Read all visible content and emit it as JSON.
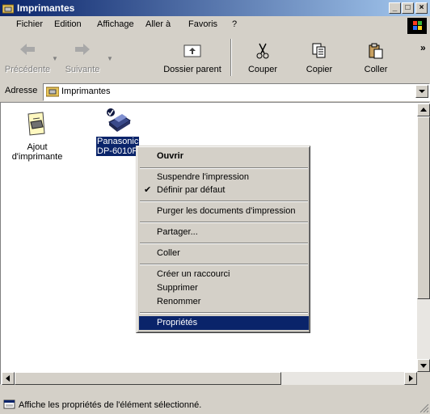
{
  "window": {
    "title": "Imprimantes"
  },
  "menu": {
    "items": [
      "Fichier",
      "Edition",
      "Affichage",
      "Aller à",
      "Favoris",
      "?"
    ]
  },
  "toolbar": {
    "back_label": "Précédente",
    "forward_label": "Suivante",
    "parent_label": "Dossier parent",
    "cut_label": "Couper",
    "copy_label": "Copier",
    "paste_label": "Coller",
    "more": "»"
  },
  "address": {
    "label": "Adresse",
    "value": "Imprimantes"
  },
  "content": {
    "items": [
      {
        "label": "Ajout d'imprimante"
      },
      {
        "label_line1": "Panasonic",
        "label_line2": "DP-6010P"
      }
    ]
  },
  "context_menu": {
    "items": [
      {
        "label": "Ouvrir"
      },
      {
        "label": "Suspendre l'impression"
      },
      {
        "label": "Définir par défaut",
        "checked": "✔"
      },
      {
        "label": "Purger les documents d'impression"
      },
      {
        "label": "Partager..."
      },
      {
        "label": "Coller"
      },
      {
        "label": "Créer un raccourci"
      },
      {
        "label": "Supprimer"
      },
      {
        "label": "Renommer"
      },
      {
        "label": "Propriétés"
      }
    ]
  },
  "status": {
    "text": "Affiche les propriétés de l'élément sélectionné."
  },
  "colors": {
    "selection": "#0a246a",
    "face": "#d4d0c8"
  }
}
